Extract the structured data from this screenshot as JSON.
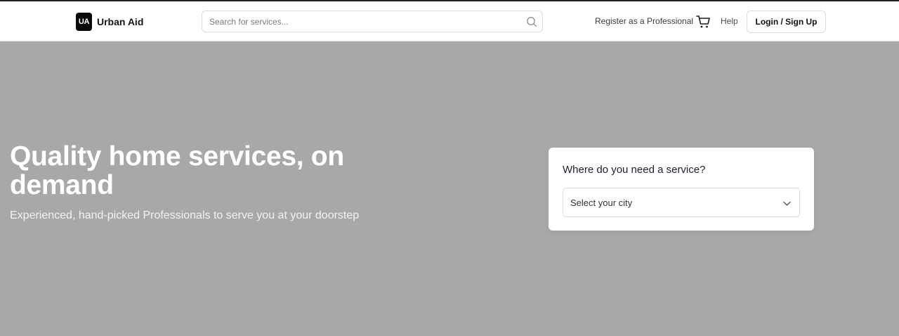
{
  "header": {
    "logo_text": "UA",
    "brand_name": "Urban Aid",
    "search": {
      "placeholder": "Search for services...",
      "value": ""
    },
    "register_label": "Register as a Professional",
    "help_label": "Help",
    "login_label": "Login / Sign Up"
  },
  "hero": {
    "title": "Quality home services, on demand",
    "subtitle": "Experienced, hand-picked Professionals to serve you at your doorstep"
  },
  "service_card": {
    "title": "Where do you need a service?",
    "city_select_value": "Select your city"
  },
  "icons": {
    "search": "search-icon",
    "cart": "cart-icon",
    "chevron": "chevron-down-icon"
  },
  "colors": {
    "hero_background": "#a8a8aa",
    "logo_background": "#0a0a0a",
    "text_dark": "#1a1f2b"
  }
}
